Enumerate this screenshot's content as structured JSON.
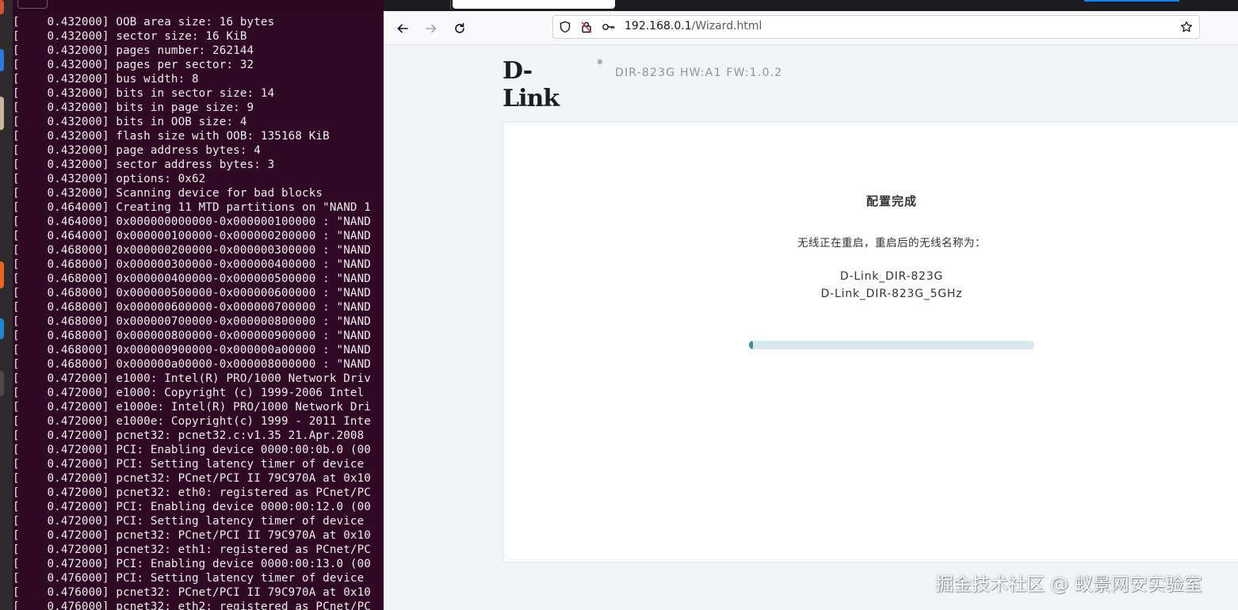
{
  "terminal": {
    "lines": [
      "[    0.432000] OOB area size: 16 bytes",
      "[    0.432000] sector size: 16 KiB",
      "[    0.432000] pages number: 262144",
      "[    0.432000] pages per sector: 32",
      "[    0.432000] bus width: 8",
      "[    0.432000] bits in sector size: 14",
      "[    0.432000] bits in page size: 9",
      "[    0.432000] bits in OOB size: 4",
      "[    0.432000] flash size with OOB: 135168 KiB",
      "[    0.432000] page address bytes: 4",
      "[    0.432000] sector address bytes: 3",
      "[    0.432000] options: 0x62",
      "[    0.432000] Scanning device for bad blocks",
      "[    0.464000] Creating 11 MTD partitions on \"NAND 1",
      "[    0.464000] 0x000000000000-0x000000100000 : \"NAND",
      "[    0.464000] 0x000000100000-0x000000200000 : \"NAND",
      "[    0.468000] 0x000000200000-0x000000300000 : \"NAND",
      "[    0.468000] 0x000000300000-0x000000400000 : \"NAND",
      "[    0.468000] 0x000000400000-0x000000500000 : \"NAND",
      "[    0.468000] 0x000000500000-0x000000600000 : \"NAND",
      "[    0.468000] 0x000000600000-0x000000700000 : \"NAND",
      "[    0.468000] 0x000000700000-0x000000800000 : \"NAND",
      "[    0.468000] 0x000000800000-0x000000900000 : \"NAND",
      "[    0.468000] 0x000000900000-0x000000a00000 : \"NAND",
      "[    0.468000] 0x000000a00000-0x000008000000 : \"NAND",
      "[    0.472000] e1000: Intel(R) PRO/1000 Network Driv",
      "[    0.472000] e1000: Copyright (c) 1999-2006 Intel",
      "[    0.472000] e1000e: Intel(R) PRO/1000 Network Dri",
      "[    0.472000] e1000e: Copyright(c) 1999 - 2011 Inte",
      "[    0.472000] pcnet32: pcnet32.c:v1.35 21.Apr.2008",
      "[    0.472000] PCI: Enabling device 0000:00:0b.0 (00",
      "[    0.472000] PCI: Setting latency timer of device",
      "[    0.472000] pcnet32: PCnet/PCI II 79C970A at 0x10",
      "[    0.472000] pcnet32: eth0: registered as PCnet/PC",
      "[    0.472000] PCI: Enabling device 0000:00:12.0 (00",
      "[    0.472000] PCI: Setting latency timer of device",
      "[    0.472000] pcnet32: PCnet/PCI II 79C970A at 0x10",
      "[    0.472000] pcnet32: eth1: registered as PCnet/PC",
      "[    0.472000] PCI: Enabling device 0000:00:13.0 (00",
      "[    0.476000] PCI: Setting latency timer of device",
      "[    0.476000] pcnet32: PCnet/PCI II 79C970A at 0x10",
      "[    0.476000] pcnet32: eth2: registered as PCnet/PC"
    ]
  },
  "browser": {
    "url_host": "192.168.0.1",
    "url_path": "/Wizard.html",
    "icons": {
      "back": "back-arrow-icon",
      "forward": "forward-arrow-icon",
      "reload": "reload-icon",
      "shield": "tracking-protection-icon",
      "insecure": "insecure-connection-icon",
      "key": "key-icon",
      "bookmark": "bookmark-star-icon"
    }
  },
  "page": {
    "logo": "D-Link",
    "model_info": "DIR-823G   HW:A1   FW:1.0.2",
    "card": {
      "title": "配置完成",
      "message": "无线正在重启，重启后的无线名称为：",
      "ssid_24g": "D-Link_DIR-823G",
      "ssid_5g": "D-Link_DIR-823G_5GHz",
      "progress_fraction": 0.015
    }
  },
  "watermark": "掘金技术社区 @ 蚁景网安实验室",
  "colors": {
    "terminal_bg": "#300a24",
    "page_bg": "#f1f4f7",
    "progress_track": "#d9e8ec",
    "progress_fill": "#3e8aa0"
  }
}
